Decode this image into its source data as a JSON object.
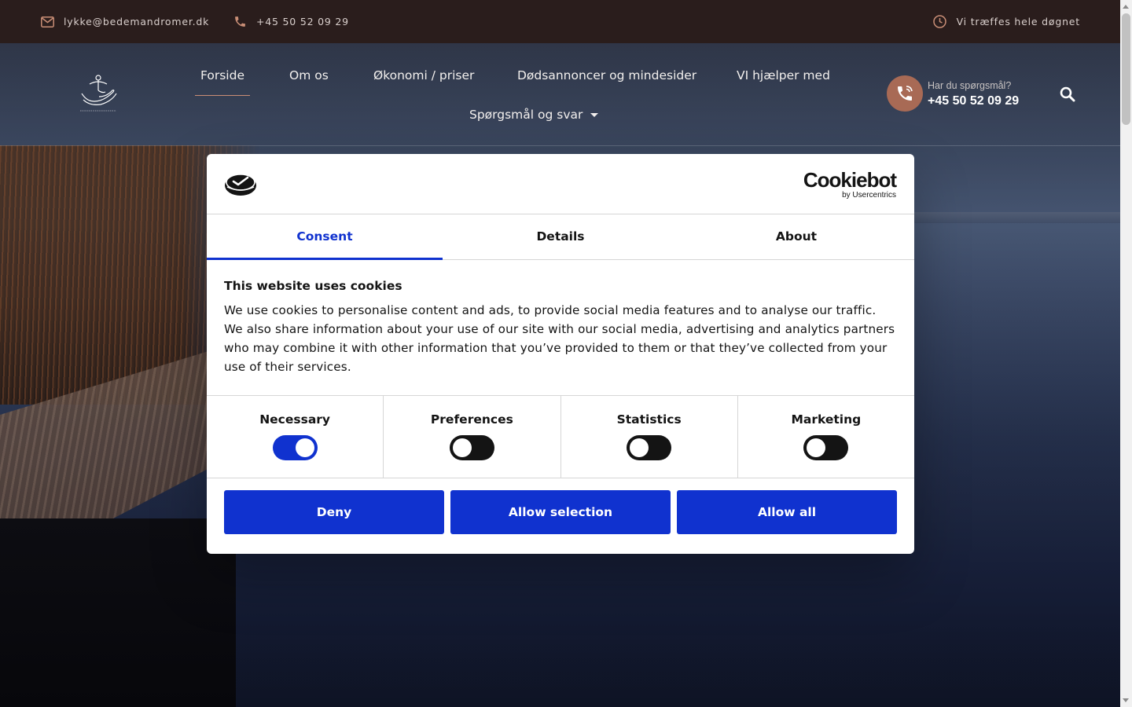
{
  "topbar": {
    "email": "lykke@bedemandromer.dk",
    "phone": "+45 50 52 09 29",
    "hours": "Vi træffes hele døgnet"
  },
  "nav": {
    "items": [
      {
        "label": "Forside"
      },
      {
        "label": "Om os"
      },
      {
        "label": "Økonomi / priser"
      },
      {
        "label": "Dødsannoncer og mindesider"
      },
      {
        "label": "VI hjælper med"
      },
      {
        "label": "Spørgsmål og svar"
      }
    ],
    "active": "Forside"
  },
  "callbox": {
    "question": "Har du spørgsmål?",
    "phone": "+45 50 52 09 29"
  },
  "dialog": {
    "brand": "Cookiebot",
    "brand_sub": "by Usercentrics",
    "tabs": [
      {
        "label": "Consent"
      },
      {
        "label": "Details"
      },
      {
        "label": "About"
      }
    ],
    "active_tab": "Consent",
    "heading": "This website uses cookies",
    "text": "We use cookies to personalise content and ads, to provide social media features and to analyse our traffic. We also share information about your use of our site with our social media, advertising and analytics partners who may combine it with other information that you’ve provided to them or that they’ve collected from your use of their services.",
    "toggles": [
      {
        "label": "Necessary",
        "on": true
      },
      {
        "label": "Preferences",
        "on": false
      },
      {
        "label": "Statistics",
        "on": false
      },
      {
        "label": "Marketing",
        "on": false
      }
    ],
    "buttons": {
      "deny": "Deny",
      "allow_selection": "Allow selection",
      "allow_all": "Allow all"
    }
  },
  "colors": {
    "accent_blue": "#1032cf",
    "topbar_bg": "#2a1d1c",
    "call_circle": "#a86a55",
    "nav_underline": "#c98e76"
  }
}
